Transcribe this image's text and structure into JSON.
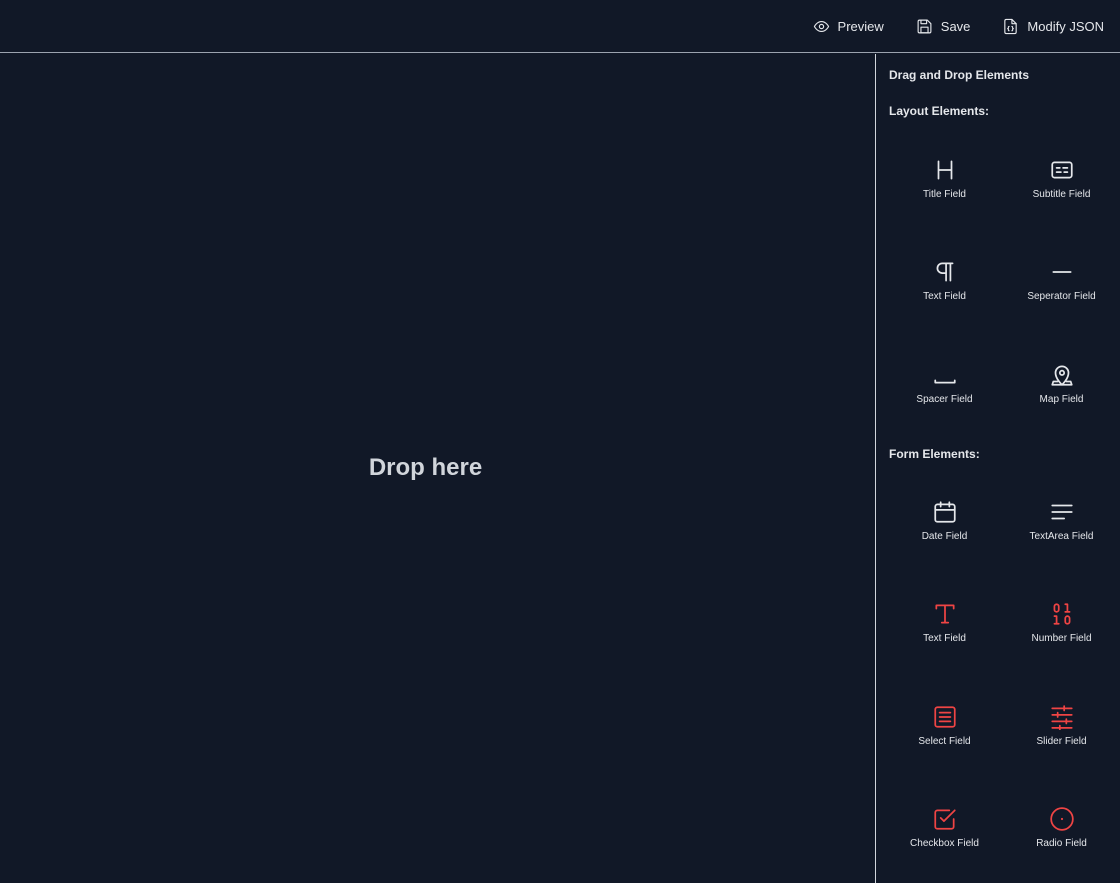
{
  "toolbar": {
    "preview_label": "Preview",
    "save_label": "Save",
    "modify_json_label": "Modify JSON"
  },
  "canvas": {
    "drop_label": "Drop here"
  },
  "sidebar": {
    "title": "Drag and Drop Elements",
    "layout_section": "Layout Elements:",
    "form_section": "Form Elements:",
    "layout_items": [
      {
        "label": "Title Field",
        "icon": "heading-icon"
      },
      {
        "label": "Subtitle Field",
        "icon": "subtitle-icon"
      },
      {
        "label": "Text Field",
        "icon": "pilcrow-icon"
      },
      {
        "label": "Seperator Field",
        "icon": "separator-icon"
      },
      {
        "label": "Spacer Field",
        "icon": "spacer-icon"
      },
      {
        "label": "Map Field",
        "icon": "map-pin-icon"
      }
    ],
    "form_items": [
      {
        "label": "Date Field",
        "icon": "calendar-icon"
      },
      {
        "label": "TextArea Field",
        "icon": "text-lines-icon"
      },
      {
        "label": "Text Field",
        "icon": "type-icon"
      },
      {
        "label": "Number Field",
        "icon": "binary-icon"
      },
      {
        "label": "Select Field",
        "icon": "list-box-icon"
      },
      {
        "label": "Slider Field",
        "icon": "sliders-icon"
      },
      {
        "label": "Checkbox Field",
        "icon": "checkbox-icon"
      },
      {
        "label": "Radio Field",
        "icon": "radio-icon"
      }
    ]
  },
  "colors": {
    "background": "#111827",
    "accent_red": "#ef4444",
    "text": "#e5e7eb"
  }
}
